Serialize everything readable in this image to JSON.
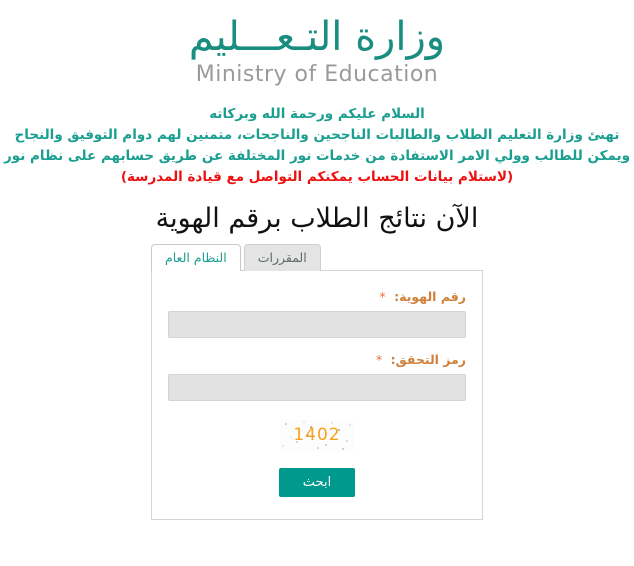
{
  "logo": {
    "arabic": "وزارة التـعـــليم",
    "english": "Ministry of Education",
    "arabic_color": "#198e80",
    "english_color": "#9a9a9a"
  },
  "greeting": {
    "lines": [
      "السلام عليكم ورحمة الله وبركاته",
      "تهنئ وزارة التعليم الطلاب والطالبات الناجحين والناجحات، متمنين لهم دوام التوفيق والنجاح",
      "ويمكن للطالب وولي الامر الاستفادة من خدمات نور المختلفة عن طريق حسابهم على نظام نور"
    ],
    "note": "(لاستلام بيانات الحساب يمكنكم التواصل مع قيادة المدرسة)",
    "text_color": "#1a9e90",
    "note_color": "#ee1111"
  },
  "headline": "الآن نتائج الطلاب برقم الهوية",
  "tabs": [
    {
      "label": "النظام العام",
      "active": true
    },
    {
      "label": "المقررات",
      "active": false
    }
  ],
  "form": {
    "fields": [
      {
        "label": "رقم الهوية:",
        "required_mark": "*",
        "value": "",
        "placeholder": ""
      },
      {
        "label": "رمز التحقق:",
        "required_mark": "*",
        "value": "",
        "placeholder": ""
      }
    ],
    "captcha": {
      "code": "1402",
      "color": "#f5a11e"
    },
    "submit_label": "ابحث",
    "submit_color": "#00998d",
    "label_color": "#d0803a"
  }
}
